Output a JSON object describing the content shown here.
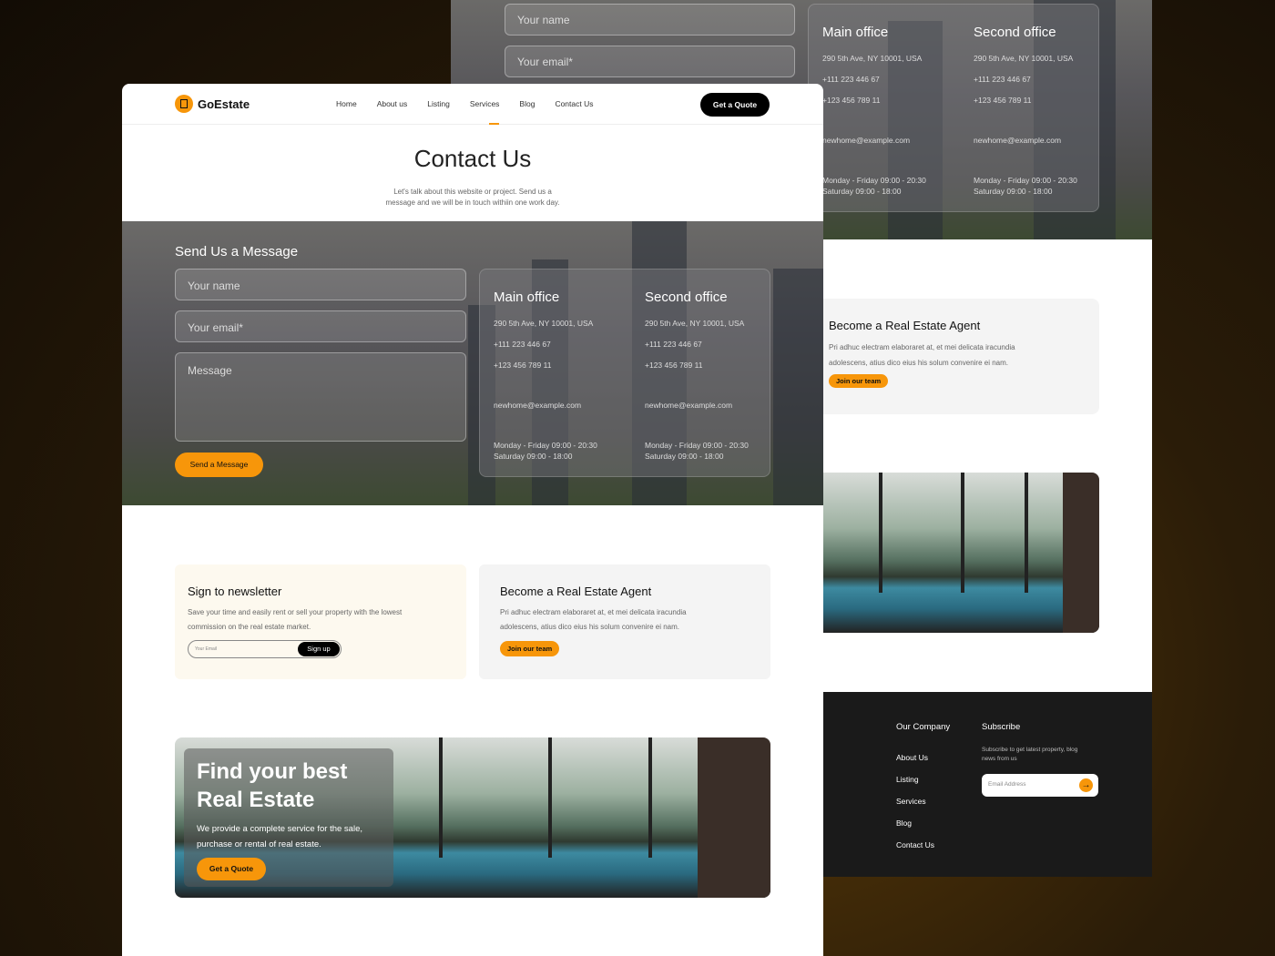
{
  "brand": {
    "name": "GoEstate",
    "accent": "#F7960A"
  },
  "nav": {
    "items": [
      "Home",
      "About us",
      "Listing",
      "Services",
      "Blog",
      "Contact Us"
    ],
    "active": "Services",
    "cta": "Get a Quote"
  },
  "hero": {
    "title": "Contact Us",
    "subtitle_1": "Let's talk about this website or project. Send us a",
    "subtitle_2": "message and we will be in touch withiin one work day."
  },
  "form": {
    "title": "Send Us a Message",
    "name_placeholder": "Your name",
    "email_placeholder": "Your email*",
    "message_placeholder": "Message",
    "submit": "Send a Message"
  },
  "offices": [
    {
      "title": "Main office",
      "address": "290 5th Ave, NY 10001, USA",
      "phone1": "+111 223 446 67",
      "phone2": "+123 456 789 11",
      "email": "newhome@example.com",
      "hours1": "Monday - Friday 09:00 - 20:30",
      "hours2": "Saturday 09:00 - 18:00"
    },
    {
      "title": "Second office",
      "address": "290 5th Ave, NY 10001, USA",
      "phone1": "+111 223 446 67",
      "phone2": "+123 456 789 11",
      "email": "newhome@example.com",
      "hours1": "Monday - Friday 09:00 - 20:30",
      "hours2": "Saturday 09:00 - 18:00"
    }
  ],
  "newsletter": {
    "title": "Sign to newsletter",
    "text_1": "Save your time and easily rent or sell your property with the lowest",
    "text_2": "commission on the real estate market.",
    "placeholder": "Your Email",
    "button": "Sign up"
  },
  "agent": {
    "title": "Become a Real Estate Agent",
    "text_1": "Pri adhuc electram elaboraret at, et mei delicata iracundia",
    "text_2": "adolescens, atius dico eius his solum convenire ei nam.",
    "button": "Join our team"
  },
  "promo": {
    "title_1": "Find your best",
    "title_2": "Real Estate",
    "text_1": "We provide a complete service for the sale,",
    "text_2": "purchase or rental of real estate.",
    "button": "Get a Quote"
  },
  "footer": {
    "company_title": "Our Company",
    "links": [
      "About Us",
      "Listing",
      "Services",
      "Blog",
      "Contact Us"
    ],
    "subscribe_title": "Subscribe",
    "subscribe_text_1": "Subscribe to get latest property, blog",
    "subscribe_text_2": "news from us",
    "email_placeholder": "Email Address"
  }
}
